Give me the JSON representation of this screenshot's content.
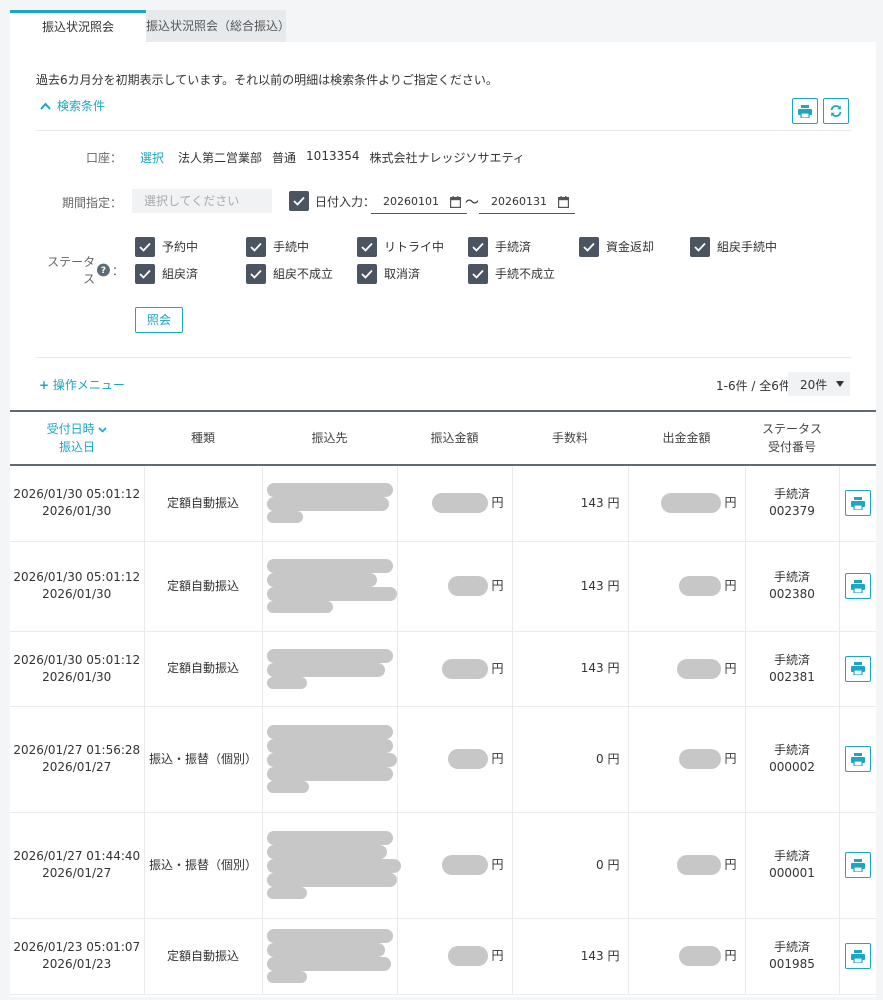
{
  "tabs": [
    {
      "label": "振込状況照会",
      "active": true
    },
    {
      "label": "振込状況照会（総合振込）",
      "active": false
    }
  ],
  "notice": "過去6カ月分を初期表示しています。それ以前の明細は検索条件よりご指定ください。",
  "search_conditions": {
    "toggle_label": "検索条件",
    "account_label": "口座：",
    "account_select": "選択",
    "account_branch": "法人第二営業部",
    "account_type": "普通",
    "account_number": "1013354",
    "account_name": "株式会社ナレッジソサエティ",
    "period_label": "期間指定：",
    "period_placeholder": "選択してください",
    "date_input_label": "日付入力：",
    "date_from": "20260101",
    "date_to": "20260131",
    "tilde": "～",
    "status_label": "ステータス",
    "statuses": [
      {
        "label": "予約中",
        "checked": true
      },
      {
        "label": "手続中",
        "checked": true
      },
      {
        "label": "リトライ中",
        "checked": true
      },
      {
        "label": "手続済",
        "checked": true
      },
      {
        "label": "資金返却",
        "checked": true
      },
      {
        "label": "組戻手続中",
        "checked": true
      },
      {
        "label": "組戻済",
        "checked": true
      },
      {
        "label": "組戻不成立",
        "checked": true
      },
      {
        "label": "取消済",
        "checked": true
      },
      {
        "label": "手続不成立",
        "checked": true
      }
    ],
    "search_button": "照会"
  },
  "ops_menu": "操作メニュー",
  "result_count": "1-6件 / 全6件",
  "per_page": "20件",
  "table": {
    "headers": {
      "received_at": "受付日時",
      "transfer_date": "振込日",
      "kind": "種類",
      "payee": "振込先",
      "amount": "振込金額",
      "fee": "手数料",
      "withdrawal": "出金金額",
      "status": "ステータス",
      "receipt_no": "受付番号"
    },
    "currency": "円",
    "rows": [
      {
        "received_at": "2026/01/30 05:01:12",
        "transfer_date": "2026/01/30",
        "kind": "定額自動振込",
        "fee": "143",
        "status": "手続済",
        "receipt_no": "002379"
      },
      {
        "received_at": "2026/01/30 05:01:12",
        "transfer_date": "2026/01/30",
        "kind": "定額自動振込",
        "fee": "143",
        "status": "手続済",
        "receipt_no": "002380"
      },
      {
        "received_at": "2026/01/30 05:01:12",
        "transfer_date": "2026/01/30",
        "kind": "定額自動振込",
        "fee": "143",
        "status": "手続済",
        "receipt_no": "002381"
      },
      {
        "received_at": "2026/01/27 01:56:28",
        "transfer_date": "2026/01/27",
        "kind": "振込・振替（個別）",
        "fee": "0",
        "status": "手続済",
        "receipt_no": "000002"
      },
      {
        "received_at": "2026/01/27 01:44:40",
        "transfer_date": "2026/01/27",
        "kind": "振込・振替（個別）",
        "fee": "0",
        "status": "手続済",
        "receipt_no": "000001"
      },
      {
        "received_at": "2026/01/23 05:01:07",
        "transfer_date": "2026/01/23",
        "kind": "定額自動振込",
        "fee": "143",
        "status": "手続済",
        "receipt_no": "001985"
      }
    ]
  },
  "colors": {
    "accent": "#1ba6c4",
    "checkbox": "#4a5561"
  }
}
